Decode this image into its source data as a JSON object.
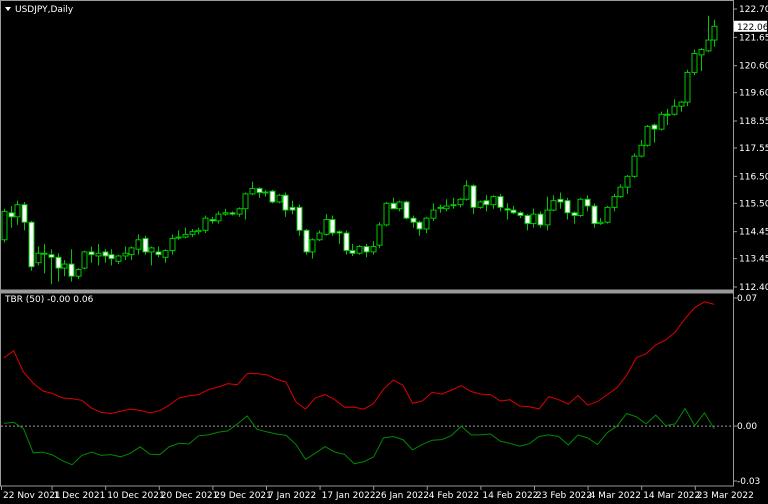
{
  "chart_data": {
    "type": "candlestick",
    "title": "USDJPY,Daily",
    "symbol": "USDJPY",
    "timeframe": "Daily",
    "current_price": "122.06",
    "colors": {
      "background": "#000000",
      "candle": "#00c800",
      "bull_body": "#000000",
      "bear_body": "#ffffff",
      "axis": "#9a9a9a",
      "tbr_upper": "#e00000",
      "tbr_lower": "#008a00"
    },
    "price_axis": {
      "ylim": [
        112.4,
        122.7
      ],
      "ticks": [
        "122.70",
        "121.65",
        "120.60",
        "119.60",
        "118.55",
        "117.55",
        "116.50",
        "115.50",
        "114.45",
        "113.45",
        "112.40"
      ]
    },
    "date_labels": [
      "22 Nov 2021",
      "1 Dec 2021",
      "10 Dec 2021",
      "20 Dec 2021",
      "29 Dec 2021",
      "7 Jan 2022",
      "17 Jan 2022",
      "26 Jan 2022",
      "4 Feb 2022",
      "14 Feb 2022",
      "23 Feb 2022",
      "4 Mar 2022",
      "14 Mar 2022",
      "23 Mar 2022"
    ],
    "date_label_every_n_bars": 8,
    "ohlc": [
      [
        114.15,
        115.3,
        114.05,
        115.2
      ],
      [
        115.15,
        115.4,
        114.6,
        115.0
      ],
      [
        115.0,
        115.6,
        114.7,
        115.45
      ],
      [
        115.45,
        115.55,
        114.5,
        114.8
      ],
      [
        114.8,
        114.85,
        113.0,
        113.15
      ],
      [
        113.3,
        113.9,
        113.2,
        113.65
      ],
      [
        113.65,
        114.0,
        112.9,
        113.65
      ],
      [
        113.6,
        113.8,
        112.5,
        113.5
      ],
      [
        113.5,
        113.65,
        112.6,
        113.1
      ],
      [
        113.1,
        113.4,
        112.8,
        113.25
      ],
      [
        113.25,
        113.8,
        112.6,
        112.8
      ],
      [
        112.8,
        113.1,
        112.7,
        113.05
      ],
      [
        113.1,
        113.75,
        113.05,
        113.7
      ],
      [
        113.7,
        113.9,
        113.3,
        113.6
      ],
      [
        113.55,
        114.0,
        113.2,
        113.65
      ],
      [
        113.7,
        113.8,
        113.3,
        113.55
      ],
      [
        113.6,
        113.8,
        113.2,
        113.45
      ],
      [
        113.35,
        113.6,
        113.25,
        113.55
      ],
      [
        113.55,
        113.9,
        113.4,
        113.65
      ],
      [
        113.6,
        113.9,
        113.4,
        113.85
      ],
      [
        113.8,
        114.35,
        113.6,
        114.15
      ],
      [
        114.2,
        114.3,
        113.6,
        113.7
      ],
      [
        113.7,
        113.9,
        113.2,
        113.85
      ],
      [
        113.7,
        113.9,
        113.5,
        113.6
      ],
      [
        113.5,
        113.8,
        113.3,
        113.75
      ],
      [
        113.75,
        114.35,
        113.6,
        114.2
      ],
      [
        114.25,
        114.5,
        114.15,
        114.25
      ],
      [
        114.25,
        114.6,
        114.2,
        114.35
      ],
      [
        114.35,
        114.55,
        114.25,
        114.45
      ],
      [
        114.45,
        114.6,
        114.35,
        114.5
      ],
      [
        114.5,
        115.05,
        114.4,
        114.95
      ],
      [
        114.9,
        115.0,
        114.75,
        114.85
      ],
      [
        114.85,
        115.2,
        114.75,
        115.1
      ],
      [
        115.1,
        115.3,
        115.05,
        115.15
      ],
      [
        115.15,
        115.2,
        115.05,
        115.1
      ],
      [
        115.1,
        115.35,
        115.0,
        115.3
      ],
      [
        115.3,
        115.9,
        114.9,
        115.85
      ],
      [
        115.85,
        116.3,
        115.8,
        116.05
      ],
      [
        116.05,
        116.1,
        115.7,
        115.9
      ],
      [
        115.9,
        116.0,
        115.75,
        115.92
      ],
      [
        115.95,
        116.0,
        115.5,
        115.55
      ],
      [
        115.55,
        115.85,
        115.5,
        115.8
      ],
      [
        115.8,
        115.9,
        115.0,
        115.25
      ],
      [
        115.35,
        115.6,
        115.1,
        115.25
      ],
      [
        115.35,
        115.45,
        114.3,
        114.5
      ],
      [
        114.5,
        114.55,
        113.6,
        113.7
      ],
      [
        113.7,
        114.2,
        113.45,
        114.15
      ],
      [
        114.15,
        114.5,
        114.1,
        114.4
      ],
      [
        114.35,
        115.1,
        114.3,
        114.9
      ],
      [
        114.9,
        115.05,
        114.3,
        114.4
      ],
      [
        114.45,
        114.5,
        114.0,
        114.4
      ],
      [
        114.4,
        114.5,
        113.6,
        113.75
      ],
      [
        113.75,
        114.0,
        113.55,
        113.65
      ],
      [
        113.65,
        113.95,
        113.6,
        113.9
      ],
      [
        113.9,
        114.0,
        113.5,
        113.7
      ],
      [
        113.7,
        114.1,
        113.6,
        113.9
      ],
      [
        113.95,
        114.8,
        113.85,
        114.7
      ],
      [
        114.7,
        115.55,
        114.65,
        115.5
      ],
      [
        115.5,
        115.7,
        115.3,
        115.3
      ],
      [
        115.3,
        115.6,
        115.2,
        115.55
      ],
      [
        115.55,
        115.6,
        114.9,
        114.95
      ],
      [
        114.95,
        115.05,
        114.6,
        114.8
      ],
      [
        114.8,
        114.85,
        114.3,
        114.55
      ],
      [
        114.55,
        115.0,
        114.4,
        114.95
      ],
      [
        114.95,
        115.5,
        114.85,
        115.25
      ],
      [
        115.33,
        115.45,
        115.15,
        115.35
      ],
      [
        115.3,
        115.65,
        115.2,
        115.4
      ],
      [
        115.44,
        115.7,
        115.3,
        115.45
      ],
      [
        115.45,
        115.7,
        115.35,
        115.65
      ],
      [
        115.65,
        116.35,
        115.6,
        116.15
      ],
      [
        116.15,
        116.2,
        115.1,
        115.35
      ],
      [
        115.35,
        115.6,
        115.3,
        115.55
      ],
      [
        115.6,
        115.8,
        115.2,
        115.45
      ],
      [
        115.45,
        115.8,
        115.3,
        115.75
      ],
      [
        115.75,
        115.85,
        115.2,
        115.35
      ],
      [
        115.3,
        115.5,
        114.9,
        115.25
      ],
      [
        115.25,
        115.4,
        115.1,
        115.15
      ],
      [
        115.15,
        115.2,
        114.95,
        115.05
      ],
      [
        115.05,
        115.1,
        114.5,
        114.75
      ],
      [
        114.75,
        115.3,
        114.6,
        115.1
      ],
      [
        115.1,
        115.2,
        114.6,
        114.7
      ],
      [
        114.7,
        115.75,
        114.5,
        115.25
      ],
      [
        115.25,
        115.8,
        115.2,
        115.6
      ],
      [
        115.65,
        115.9,
        115.3,
        115.55
      ],
      [
        115.6,
        115.7,
        114.9,
        115.15
      ],
      [
        115.15,
        115.2,
        114.75,
        115.05
      ],
      [
        115.05,
        115.7,
        115.0,
        115.65
      ],
      [
        115.65,
        115.8,
        115.2,
        115.4
      ],
      [
        115.4,
        115.5,
        114.6,
        114.75
      ],
      [
        114.75,
        114.95,
        114.7,
        114.8
      ],
      [
        114.8,
        115.4,
        114.75,
        115.35
      ],
      [
        115.35,
        115.85,
        115.2,
        115.75
      ],
      [
        115.75,
        116.2,
        115.7,
        116.1
      ],
      [
        116.1,
        116.55,
        115.85,
        116.5
      ],
      [
        116.5,
        117.35,
        116.45,
        117.25
      ],
      [
        117.25,
        117.85,
        117.2,
        117.65
      ],
      [
        117.65,
        118.4,
        117.6,
        118.35
      ],
      [
        118.4,
        118.45,
        117.75,
        118.25
      ],
      [
        118.25,
        118.9,
        118.2,
        118.8
      ],
      [
        118.78,
        119.0,
        118.4,
        118.8
      ],
      [
        118.8,
        119.35,
        118.75,
        119.1
      ],
      [
        119.1,
        119.3,
        118.9,
        119.25
      ],
      [
        119.25,
        120.45,
        119.1,
        120.35
      ],
      [
        120.35,
        121.2,
        120.25,
        121.05
      ],
      [
        121.0,
        121.25,
        120.4,
        121.2
      ],
      [
        121.15,
        122.45,
        121.1,
        121.55
      ],
      [
        121.55,
        122.3,
        121.3,
        122.06
      ]
    ],
    "indicator": {
      "label": "TBR (50) -0.00 0.06",
      "ylim": [
        -0.03,
        0.07
      ],
      "ticks": [
        "0.07",
        "0.00",
        "-0.03"
      ],
      "zero_line": 0.0,
      "upper_series": [
        0.0372,
        0.0412,
        0.0295,
        0.0235,
        0.0192,
        0.0178,
        0.0154,
        0.0149,
        0.0141,
        0.0098,
        0.0075,
        0.0069,
        0.0081,
        0.0093,
        0.0086,
        0.0072,
        0.0084,
        0.0115,
        0.0154,
        0.0165,
        0.0172,
        0.0199,
        0.0213,
        0.0232,
        0.0226,
        0.0287,
        0.0287,
        0.0281,
        0.0257,
        0.024,
        0.0132,
        0.0093,
        0.0154,
        0.0172,
        0.0144,
        0.0103,
        0.0103,
        0.0093,
        0.0124,
        0.0201,
        0.0252,
        0.0223,
        0.0124,
        0.0137,
        0.0184,
        0.0175,
        0.0197,
        0.0221,
        0.0189,
        0.0175,
        0.0172,
        0.0137,
        0.0144,
        0.011,
        0.0106,
        0.0094,
        0.0161,
        0.0144,
        0.012,
        0.0168,
        0.0115,
        0.0134,
        0.0172,
        0.0209,
        0.0278,
        0.0374,
        0.0395,
        0.0444,
        0.047,
        0.0515,
        0.0587,
        0.0647,
        0.0679,
        0.0665
      ],
      "lower_series": [
        0.0015,
        0.0021,
        -0.0014,
        -0.0146,
        -0.0142,
        -0.0158,
        -0.0189,
        -0.0211,
        -0.016,
        -0.0142,
        -0.016,
        -0.0156,
        -0.0168,
        -0.0148,
        -0.0113,
        -0.0154,
        -0.0156,
        -0.0112,
        -0.0094,
        -0.0098,
        -0.0053,
        -0.0048,
        -0.0034,
        -0.0026,
        0.0012,
        0.0055,
        -0.0017,
        -0.0031,
        -0.0043,
        -0.0051,
        -0.01,
        -0.0182,
        -0.0148,
        -0.0112,
        -0.0142,
        -0.0154,
        -0.0206,
        -0.0194,
        -0.0168,
        -0.0065,
        -0.0057,
        -0.0074,
        -0.013,
        -0.01,
        -0.0077,
        -0.0074,
        -0.0051,
        0.0,
        -0.0048,
        -0.0048,
        -0.0043,
        -0.0082,
        -0.0094,
        -0.011,
        -0.0096,
        -0.0057,
        -0.0048,
        -0.0057,
        -0.0103,
        -0.0048,
        -0.0065,
        -0.01,
        -0.0036,
        0.0,
        0.0069,
        0.0051,
        0.0012,
        0.006,
        0.0003,
        0.0012,
        0.0096,
        0.0003,
        0.0072,
        -0.0014
      ]
    }
  }
}
